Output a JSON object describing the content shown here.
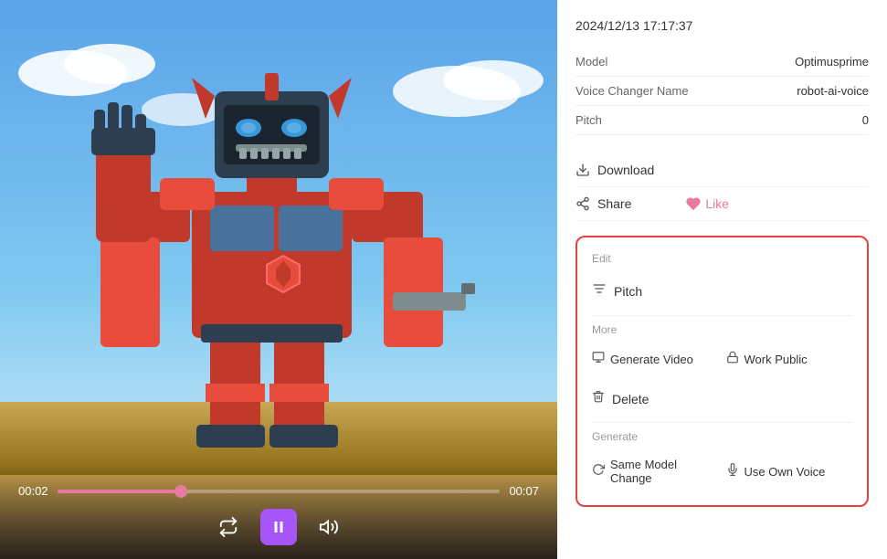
{
  "video": {
    "time_current": "00:02",
    "time_total": "00:07",
    "progress_percent": 28
  },
  "metadata": {
    "timestamp": "2024/12/13 17:17:37",
    "model_label": "Model",
    "model_value": "Optimusprime",
    "voice_changer_label": "Voice Changer Name",
    "voice_changer_value": "robot-ai-voice",
    "pitch_label": "Pitch",
    "pitch_value": "0"
  },
  "actions": {
    "download_label": "Download",
    "share_label": "Share",
    "like_label": "Like"
  },
  "edit_section": {
    "section_title": "Edit",
    "pitch_label": "Pitch"
  },
  "more_section": {
    "section_title": "More",
    "generate_video_label": "Generate Video",
    "work_public_label": "Work Public",
    "delete_label": "Delete"
  },
  "generate_section": {
    "section_title": "Generate",
    "same_model_label": "Same Model Change",
    "use_own_voice_label": "Use Own Voice"
  },
  "controls": {
    "repeat_icon": "⇄",
    "play_icon": "⏸",
    "volume_icon": "🔊"
  }
}
